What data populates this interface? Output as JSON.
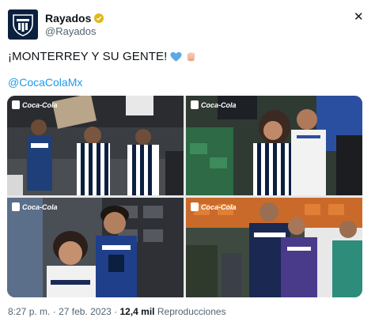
{
  "tweet": {
    "account_name": "Rayados",
    "handle": "@Rayados",
    "text": "¡MONTERREY Y SU GENTE!",
    "emojis": [
      "blue-heart",
      "raised-hand"
    ],
    "mention": "@CocaColaMx",
    "photo_tag": "Coca-Cola",
    "time": "8:27 p. m.",
    "sep": "·",
    "date": "27 feb. 2023",
    "views_count": "12,4 mil",
    "views_label": "Reproducciones"
  },
  "icons": {
    "close": "close-icon",
    "verified": "verified-badge-icon",
    "avatar": "club-crest-icon"
  },
  "colors": {
    "link": "#1d9bf0",
    "verified": "#e2b719",
    "club_navy": "#0b1f3f"
  }
}
